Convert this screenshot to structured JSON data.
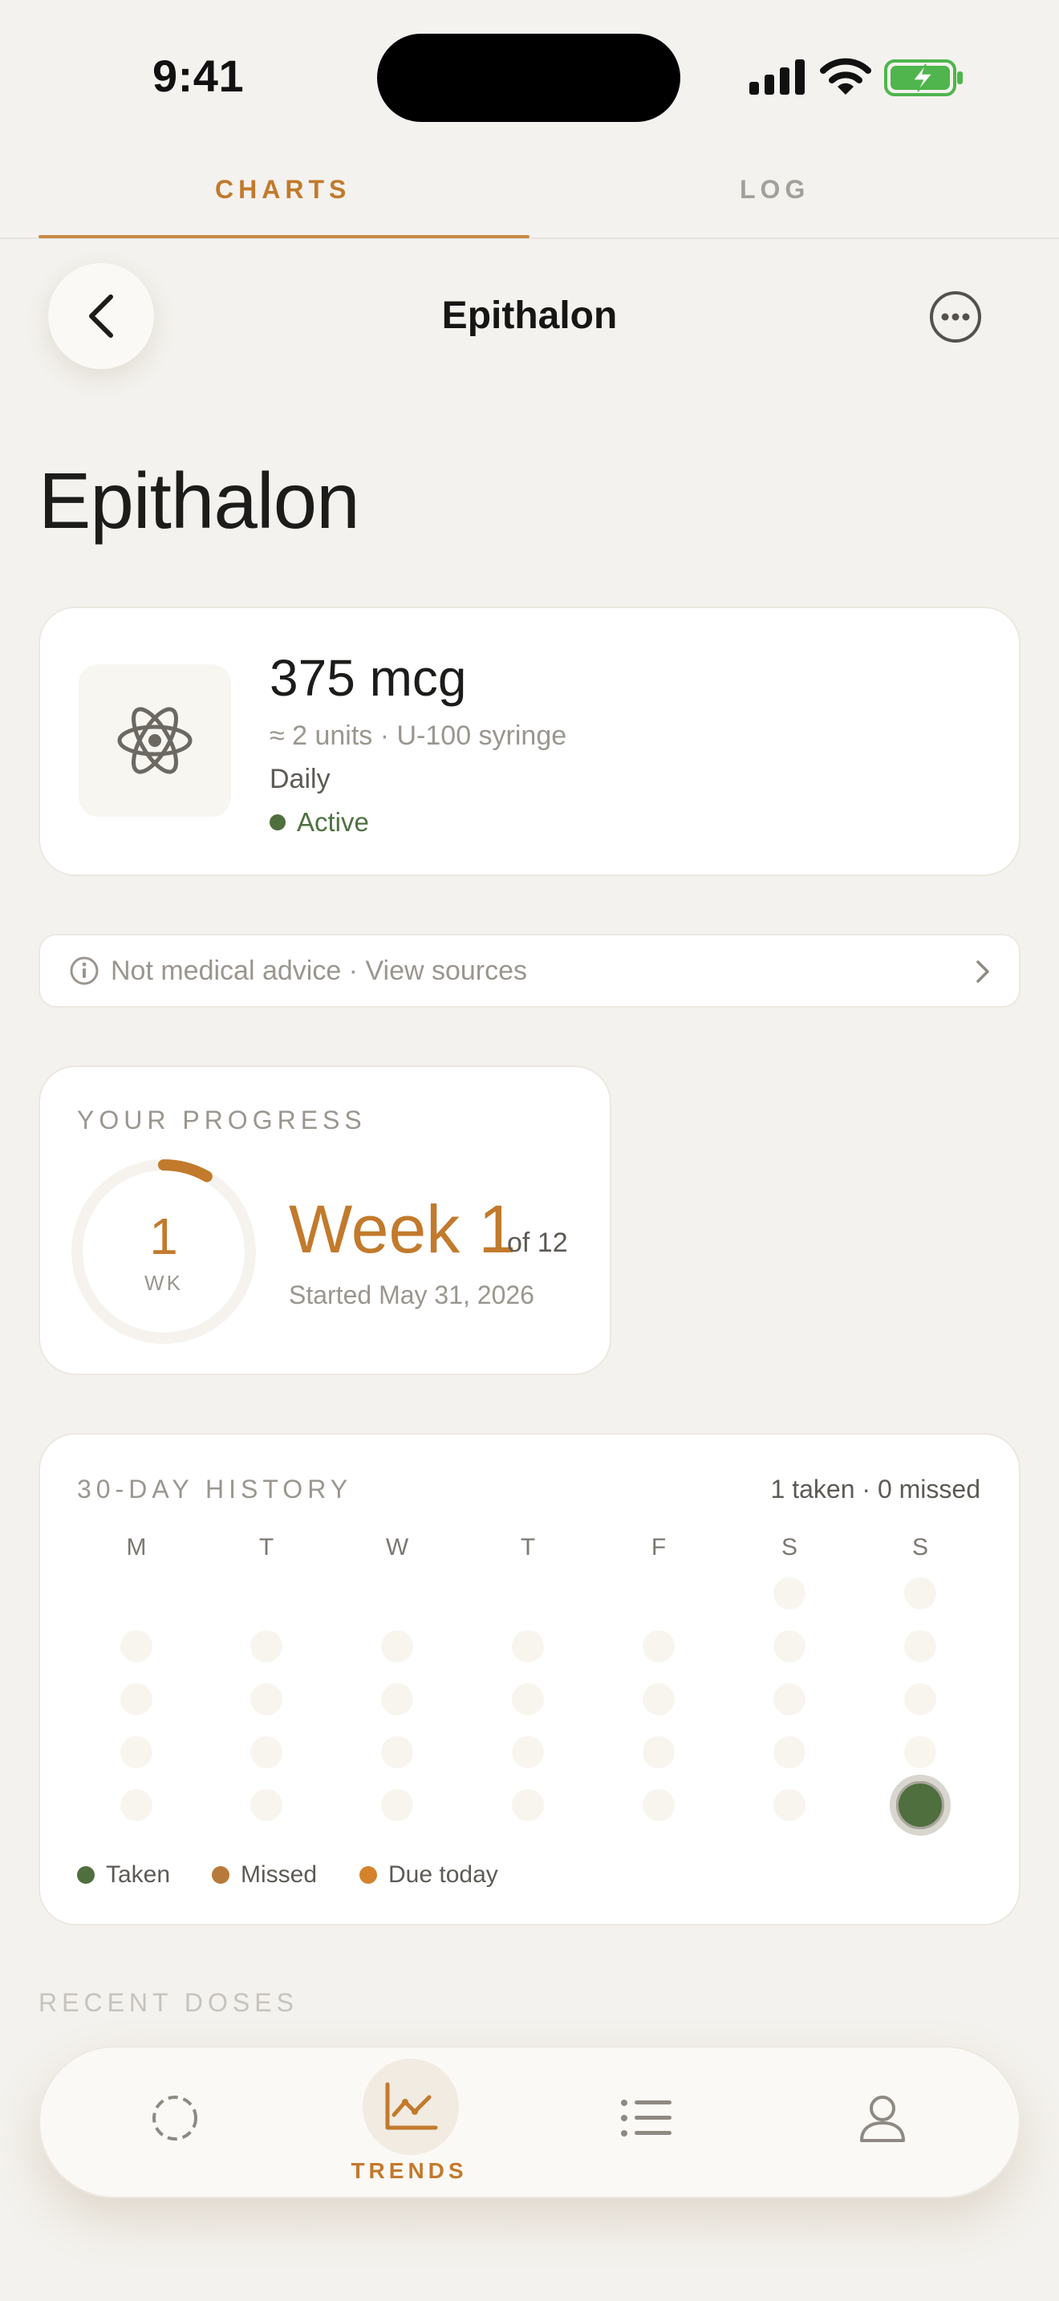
{
  "status_bar": {
    "time": "9:41"
  },
  "tabs": [
    {
      "label": "CHARTS",
      "active": true
    },
    {
      "label": "LOG",
      "active": false
    }
  ],
  "header": {
    "title": "Epithalon"
  },
  "page": {
    "title": "Epithalon"
  },
  "dose": {
    "amount": "375 mcg",
    "units": "≈ 2 units · U-100 syringe",
    "frequency": "Daily",
    "status": "Active",
    "icon": "atom-icon"
  },
  "advice": {
    "text": "Not medical advice · View sources"
  },
  "progress": {
    "section_label": "YOUR PROGRESS",
    "ring_number": "1",
    "ring_unit": "WK",
    "week_label": "Week 1",
    "of_label": "of 12",
    "started": "Started May 31, 2026",
    "fraction": 0.083
  },
  "history": {
    "section_label": "30-DAY HISTORY",
    "summary": "1 taken · 0 missed",
    "weekdays": [
      "M",
      "T",
      "W",
      "T",
      "F",
      "S",
      "S"
    ],
    "legend": [
      {
        "label": "Taken",
        "color": "#4f6f3e"
      },
      {
        "label": "Missed",
        "color": "#b87a3c"
      },
      {
        "label": "Due today",
        "color": "#d4832c"
      }
    ]
  },
  "recent": {
    "section_label": "RECENT DOSES"
  },
  "nav": {
    "items": [
      {
        "icon": "dashed-circle-icon"
      },
      {
        "icon": "trends-chart-icon",
        "label": "TRENDS",
        "active": true
      },
      {
        "icon": "list-icon"
      },
      {
        "icon": "profile-icon"
      }
    ]
  },
  "colors": {
    "accent": "#c27a2c",
    "taken": "#4f6f3e",
    "background": "#f4f2ee"
  }
}
